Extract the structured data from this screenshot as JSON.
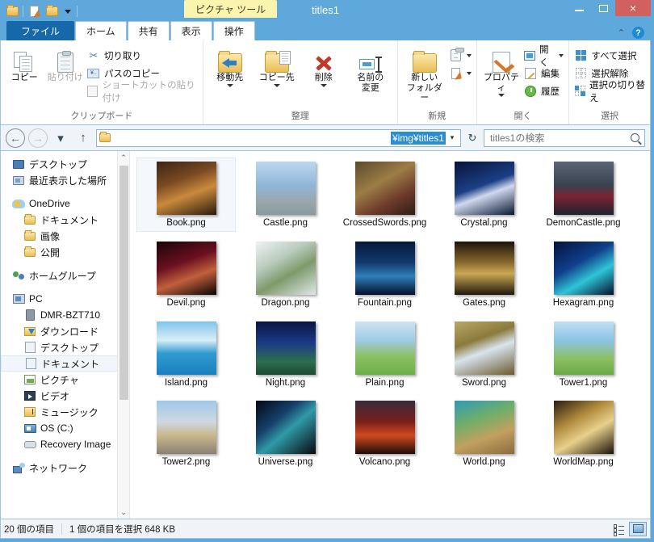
{
  "window": {
    "title": "titles1",
    "picture_tools_tab": "ピクチャ ツール",
    "minimize": "minimize-button",
    "maximize": "maximize-button",
    "close": "×"
  },
  "ribbon": {
    "tabs": [
      {
        "label": "ファイル",
        "active": false,
        "file": true
      },
      {
        "label": "ホーム",
        "active": true
      },
      {
        "label": "共有",
        "active": false
      },
      {
        "label": "表示",
        "active": false
      },
      {
        "label": "操作",
        "active": false
      }
    ],
    "collapse_chevron": "⌃",
    "help": "?",
    "groups": {
      "clipboard": {
        "title": "クリップボード",
        "copy": "コピー",
        "paste": "貼り付け",
        "cut": "切り取り",
        "copy_path": "パスのコピー",
        "paste_shortcut": "ショートカットの貼り付け"
      },
      "organize": {
        "title": "整理",
        "move_to": "移動先",
        "copy_to": "コピー先",
        "delete": "削除",
        "rename": "名前の\n変更",
        "rename_line1": "名前の",
        "rename_line2": "変更"
      },
      "new": {
        "title": "新規",
        "new_folder_line1": "新しい",
        "new_folder_line2": "フォルダー"
      },
      "open": {
        "title": "開く",
        "properties": "プロパティ",
        "open": "開く",
        "edit": "編集",
        "history": "履歴"
      },
      "select": {
        "title": "選択",
        "select_all": "すべて選択",
        "select_none": "選択解除",
        "invert_selection": "選択の切り替え"
      }
    }
  },
  "navbar": {
    "back": "←",
    "forward": "→",
    "recent_caret": "▾",
    "up": "↑",
    "address_path": "¥img¥titles1",
    "address_caret": "▾",
    "refresh": "↻",
    "search_placeholder": "titles1の検索"
  },
  "navpane": {
    "items": [
      {
        "label": "デスクトップ",
        "icon": "monitor-icon",
        "level": 1,
        "selected": false
      },
      {
        "label": "最近表示した場所",
        "icon": "recent-places-icon",
        "level": 1,
        "selected": false
      },
      {
        "label": "",
        "icon": "spacer",
        "level": 0,
        "spacer": true
      },
      {
        "label": "OneDrive",
        "icon": "cloud-icon",
        "level": 0,
        "selected": false
      },
      {
        "label": "ドキュメント",
        "icon": "folder-icon",
        "level": 2,
        "selected": false
      },
      {
        "label": "画像",
        "icon": "folder-icon",
        "level": 2,
        "selected": false
      },
      {
        "label": "公開",
        "icon": "folder-icon",
        "level": 2,
        "selected": false
      },
      {
        "label": "",
        "icon": "spacer",
        "level": 0,
        "spacer": true
      },
      {
        "label": "ホームグループ",
        "icon": "homegroup-icon",
        "level": 0,
        "selected": false
      },
      {
        "label": "",
        "icon": "spacer",
        "level": 0,
        "spacer": true
      },
      {
        "label": "PC",
        "icon": "pc-icon",
        "level": 0,
        "selected": false
      },
      {
        "label": "DMR-BZT710",
        "icon": "device-icon",
        "level": 2,
        "selected": false
      },
      {
        "label": "ダウンロード",
        "icon": "downloads-icon",
        "level": 2,
        "selected": false
      },
      {
        "label": "デスクトップ",
        "icon": "desktop-folder-icon",
        "level": 2,
        "selected": false
      },
      {
        "label": "ドキュメント",
        "icon": "documents-icon",
        "level": 2,
        "selected": true
      },
      {
        "label": "ピクチャ",
        "icon": "pictures-icon",
        "level": 2,
        "selected": false
      },
      {
        "label": "ビデオ",
        "icon": "videos-icon",
        "level": 2,
        "selected": false
      },
      {
        "label": "ミュージック",
        "icon": "music-icon",
        "level": 2,
        "selected": false
      },
      {
        "label": "OS (C:)",
        "icon": "harddisk-icon",
        "level": 2,
        "selected": false
      },
      {
        "label": "Recovery Image",
        "icon": "drive-icon",
        "level": 2,
        "selected": false
      },
      {
        "label": "",
        "icon": "spacer",
        "level": 0,
        "spacer": true
      },
      {
        "label": "ネットワーク",
        "icon": "network-icon",
        "level": 0,
        "selected": false
      }
    ],
    "scroll_up": "⌃",
    "scroll_down": "⌄"
  },
  "files": [
    {
      "name": "Book.png",
      "selected": true,
      "grad": "linear-gradient(160deg,#3a2414 0%,#7a4a22 35%,#c98a3c 60%,#2b1a0e 100%)"
    },
    {
      "name": "Castle.png",
      "selected": false,
      "grad": "linear-gradient(180deg,#bcd8ef 0%,#8fb6d8 45%,#9aa7ab 75%,#8b9aa0 100%)"
    },
    {
      "name": "CrossedSwords.png",
      "selected": false,
      "grad": "linear-gradient(150deg,#5b4a2c 0%,#9b7d46 40%,#6d3a2a 70%,#2c1d12 100%)"
    },
    {
      "name": "Crystal.png",
      "selected": false,
      "grad": "linear-gradient(160deg,#081436 0%,#1b3f86 45%,#cfd9ee 60%,#0a1530 100%)"
    },
    {
      "name": "DemonCastle.png",
      "selected": false,
      "grad": "linear-gradient(180deg,#5d6676 0%,#39424f 45%,#7c2230 65%,#1d2430 100%)"
    },
    {
      "name": "Devil.png",
      "selected": false,
      "grad": "linear-gradient(160deg,#1a0508 0%,#6b1020 40%,#c0603c 65%,#0b0305 100%)"
    },
    {
      "name": "Dragon.png",
      "selected": false,
      "grad": "linear-gradient(150deg,#eef3f6 0%,#b9cbbd 35%,#7d9a6a 60%,#dfe8ea 100%)"
    },
    {
      "name": "Fountain.png",
      "selected": false,
      "grad": "linear-gradient(180deg,#07183a 0%,#123a6e 40%,#2f7fb8 65%,#05102a 100%)"
    },
    {
      "name": "Gates.png",
      "selected": false,
      "grad": "linear-gradient(180deg,#1c1408 0%,#8a6b2d 40%,#cba855 60%,#20180c 100%)"
    },
    {
      "name": "Hexagram.png",
      "selected": false,
      "grad": "linear-gradient(150deg,#07123a 0%,#0f3f8c 40%,#2fc4d8 65%,#061029 100%)"
    },
    {
      "name": "Island.png",
      "selected": false,
      "grad": "linear-gradient(180deg,#7fc4e8 0%,#d8eef8 35%,#2f9ad0 60%,#1c7fbd 100%)"
    },
    {
      "name": "Night.png",
      "selected": false,
      "grad": "linear-gradient(180deg,#0a1444 0%,#1c3a86 40%,#2e6e4e 75%,#1b4a32 100%)"
    },
    {
      "name": "Plain.png",
      "selected": false,
      "grad": "linear-gradient(180deg,#cfe3f1 0%,#9fcbe6 35%,#8cc061 65%,#6fae4c 100%)"
    },
    {
      "name": "Sword.png",
      "selected": false,
      "grad": "linear-gradient(160deg,#b7a86a 0%,#8a7a3c 35%,#d9e4ee 55%,#6b5a2c 100%)"
    },
    {
      "name": "Tower1.png",
      "selected": false,
      "grad": "linear-gradient(180deg,#bfe0f2 0%,#8cc4e6 35%,#8cc061 70%,#6aa848 100%)"
    },
    {
      "name": "Tower2.png",
      "selected": false,
      "grad": "linear-gradient(180deg,#9ec8e8 0%,#cfd8e0 40%,#c9b88c 65%,#8a8070 100%)"
    },
    {
      "name": "Universe.png",
      "selected": false,
      "grad": "linear-gradient(140deg,#050814 0%,#16406b 35%,#2f9aa8 55%,#06080f 100%)"
    },
    {
      "name": "Volcano.png",
      "selected": false,
      "grad": "linear-gradient(180deg,#3a2a3a 0%,#7a2018 40%,#d04a20 65%,#200c0a 100%)"
    },
    {
      "name": "World.png",
      "selected": false,
      "grad": "linear-gradient(160deg,#2f9ab8 0%,#6fae6a 35%,#c2a060 65%,#8a6b3c 100%)"
    },
    {
      "name": "WorldMap.png",
      "selected": false,
      "grad": "linear-gradient(150deg,#2a1c10 0%,#b08a3c 35%,#e8d08a 60%,#1c1208 100%)"
    }
  ],
  "status": {
    "item_count": "20 個の項目",
    "selection": "1 個の項目を選択  648 KB",
    "view_details": "details-view",
    "view_large_icons": "large-icons-view"
  }
}
